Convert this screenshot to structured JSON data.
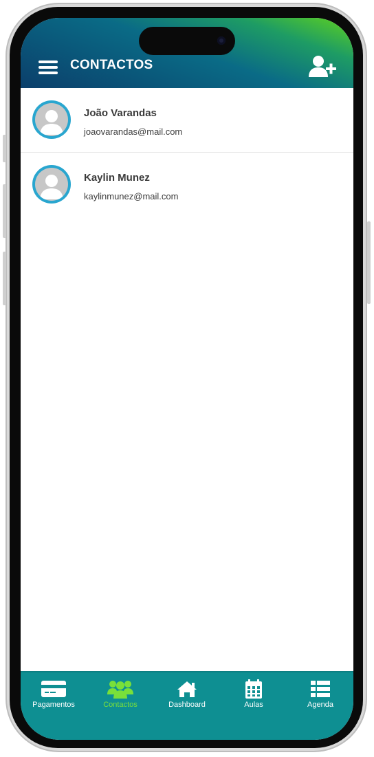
{
  "header": {
    "title": "CONTACTOS",
    "menu_icon": "hamburger-icon",
    "add_icon": "add-user-icon"
  },
  "contacts": [
    {
      "name": "João Varandas",
      "email": "joaovarandas@mail.com"
    },
    {
      "name": "Kaylin Munez",
      "email": "kaylinmunez@mail.com"
    }
  ],
  "bottom_nav": {
    "items": [
      {
        "label": "Pagamentos",
        "icon": "credit-card-icon",
        "active": false
      },
      {
        "label": "Contactos",
        "icon": "users-icon",
        "active": true
      },
      {
        "label": "Dashboard",
        "icon": "home-icon",
        "active": false
      },
      {
        "label": "Aulas",
        "icon": "calendar-icon",
        "active": false
      },
      {
        "label": "Agenda",
        "icon": "list-icon",
        "active": false
      }
    ]
  },
  "colors": {
    "header_gradient": [
      "#5fd21e",
      "#0a6b86",
      "#0b3f6b"
    ],
    "nav_background": "#0e8f92",
    "active": "#79e03a",
    "avatar_ring": "#29a6cf"
  }
}
